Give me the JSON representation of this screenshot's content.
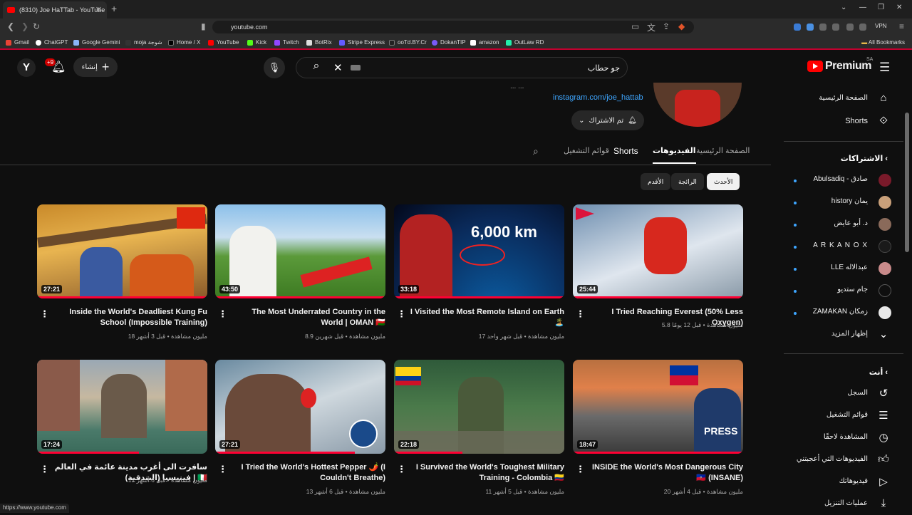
{
  "browser": {
    "tab_title": "(8310) Joe HaTTab - YouTube",
    "url": "youtube.com",
    "status_url": "https://www.youtube.com",
    "vpn_label": "VPN",
    "bookmarks": [
      "Gmail",
      "ChatGPT",
      "Google Gemini",
      "moja شوجة",
      "Home / X",
      "YouTube",
      "Kick",
      "Twitch",
      "BotRix",
      "Stripe Express",
      "ooTd.BY.Cr",
      "DokanTIP",
      "amazon",
      "OutLaw RD"
    ],
    "all_bookmarks": "All Bookmarks"
  },
  "header": {
    "avatar_letter": "Y",
    "notif_count": "+9",
    "create_label": "إنشاء",
    "search_value": "جو حطاب",
    "logo_text": "Premium",
    "logo_region": "SA"
  },
  "channel": {
    "partial_text": "... ...",
    "instagram": "instagram.com/joe_hattab",
    "subscribed_label": "تم الاشتراك",
    "tabs": [
      "الصفحة الرئيسية",
      "الفيديوهات",
      "Shorts",
      "قوائم التشغيل"
    ],
    "chips": [
      "الأحدث",
      "الرائجة",
      "الأقدم"
    ]
  },
  "videos": [
    {
      "title": "I Tried Reaching Everest (50% Less Oxygen)",
      "meta": "5.8 مليون مشاهدة • قبل 12 يومًا",
      "duration": "25:44"
    },
    {
      "title": "I Visited the Most Remote Island on Earth 🏝️",
      "meta": "17 مليون مشاهدة • قبل شهر واحد",
      "duration": "33:18"
    },
    {
      "title": "The Most Underrated Country in the World | OMAN 🇴🇲",
      "meta": "8.9 مليون مشاهدة • قبل شهرين",
      "duration": "43:50"
    },
    {
      "title": "Inside the World's Deadliest Kung Fu School (Impossible Training)",
      "meta": "18 مليون مشاهدة • قبل 3 أشهر",
      "duration": "27:21"
    },
    {
      "title": "INSIDE the World's Most Dangerous City 🇭🇹 (INSANE)",
      "meta": "20 مليون مشاهدة • قبل 4 أشهر",
      "duration": "18:47"
    },
    {
      "title": "I Survived the World's Toughest Military Training - Colombia 🇨🇴",
      "meta": "11 مليون مشاهدة • قبل 5 أشهر",
      "duration": "22:18"
    },
    {
      "title": "I Tried the World's Hottest Pepper 🌶️ (I Couldn't Breathe)",
      "meta": "13 مليون مشاهدة • قبل 6 أشهر",
      "duration": "27:21"
    },
    {
      "title": "سافرت الى أغرب مدينة عائمة في العالم | فينيسيا (البندقية) 🇮🇹",
      "meta": "12 مليون مشاهدة • قبل 6 أشهر",
      "duration": "17:24"
    }
  ],
  "sidebar": {
    "home": "الصفحة الرئيسية",
    "shorts": "Shorts",
    "subscriptions_header": "الاشتراكات",
    "subscriptions": [
      "Abulsadiq - صادق",
      "history يمان",
      "د. أبو عايض",
      "A R K A N O X",
      "LLE عبدالاله",
      "جام ستديو",
      "ZAMAKAN زمكان"
    ],
    "show_more": "إظهار المزيد",
    "you_header": "أنت",
    "you_items": [
      "السجل",
      "قوائم التشغيل",
      "المشاهدة لاحقًا",
      "الفيديوهات التي أعجبتني",
      "فيديوهاتك",
      "عمليات التنزيل"
    ]
  },
  "colors": {
    "accent": "#ff0033",
    "link": "#3ea6ff",
    "bg": "#0f0f0f"
  }
}
